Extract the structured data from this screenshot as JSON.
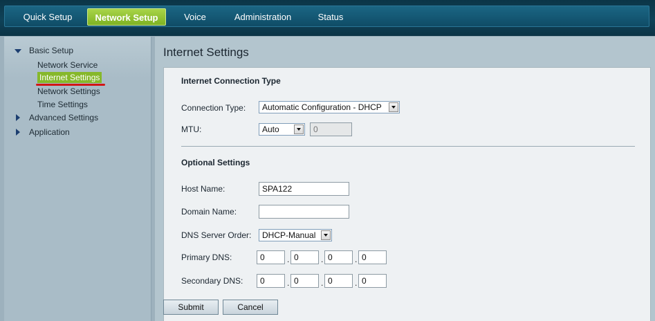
{
  "nav": {
    "items": [
      {
        "label": "Quick Setup",
        "active": false
      },
      {
        "label": "Network Setup",
        "active": true
      },
      {
        "label": "Voice",
        "active": false
      },
      {
        "label": "Administration",
        "active": false
      },
      {
        "label": "Status",
        "active": false
      }
    ],
    "active_color": "#8cc234"
  },
  "sidebar": {
    "basic_setup": "Basic Setup",
    "children": [
      "Network Service",
      "Internet Settings",
      "Network Settings",
      "Time Settings"
    ],
    "selected": "Internet Settings",
    "advanced_settings": "Advanced Settings",
    "application": "Application"
  },
  "page": {
    "title": "Internet Settings"
  },
  "connection": {
    "section_title": "Internet Connection Type",
    "type_label": "Connection Type:",
    "type_value": "Automatic Configuration - DHCP",
    "mtu_label": "MTU:",
    "mtu_mode": "Auto",
    "mtu_value": "0"
  },
  "optional": {
    "section_title": "Optional Settings",
    "host_label": "Host Name:",
    "host_value": "SPA122",
    "domain_label": "Domain Name:",
    "domain_value": "",
    "dns_order_label": "DNS Server Order:",
    "dns_order_value": "DHCP-Manual",
    "primary_dns_label": "Primary DNS:",
    "primary_dns": [
      "0",
      "0",
      "0",
      "0"
    ],
    "secondary_dns_label": "Secondary DNS:",
    "secondary_dns": [
      "0",
      "0",
      "0",
      "0"
    ]
  },
  "buttons": {
    "submit": "Submit",
    "cancel": "Cancel"
  }
}
